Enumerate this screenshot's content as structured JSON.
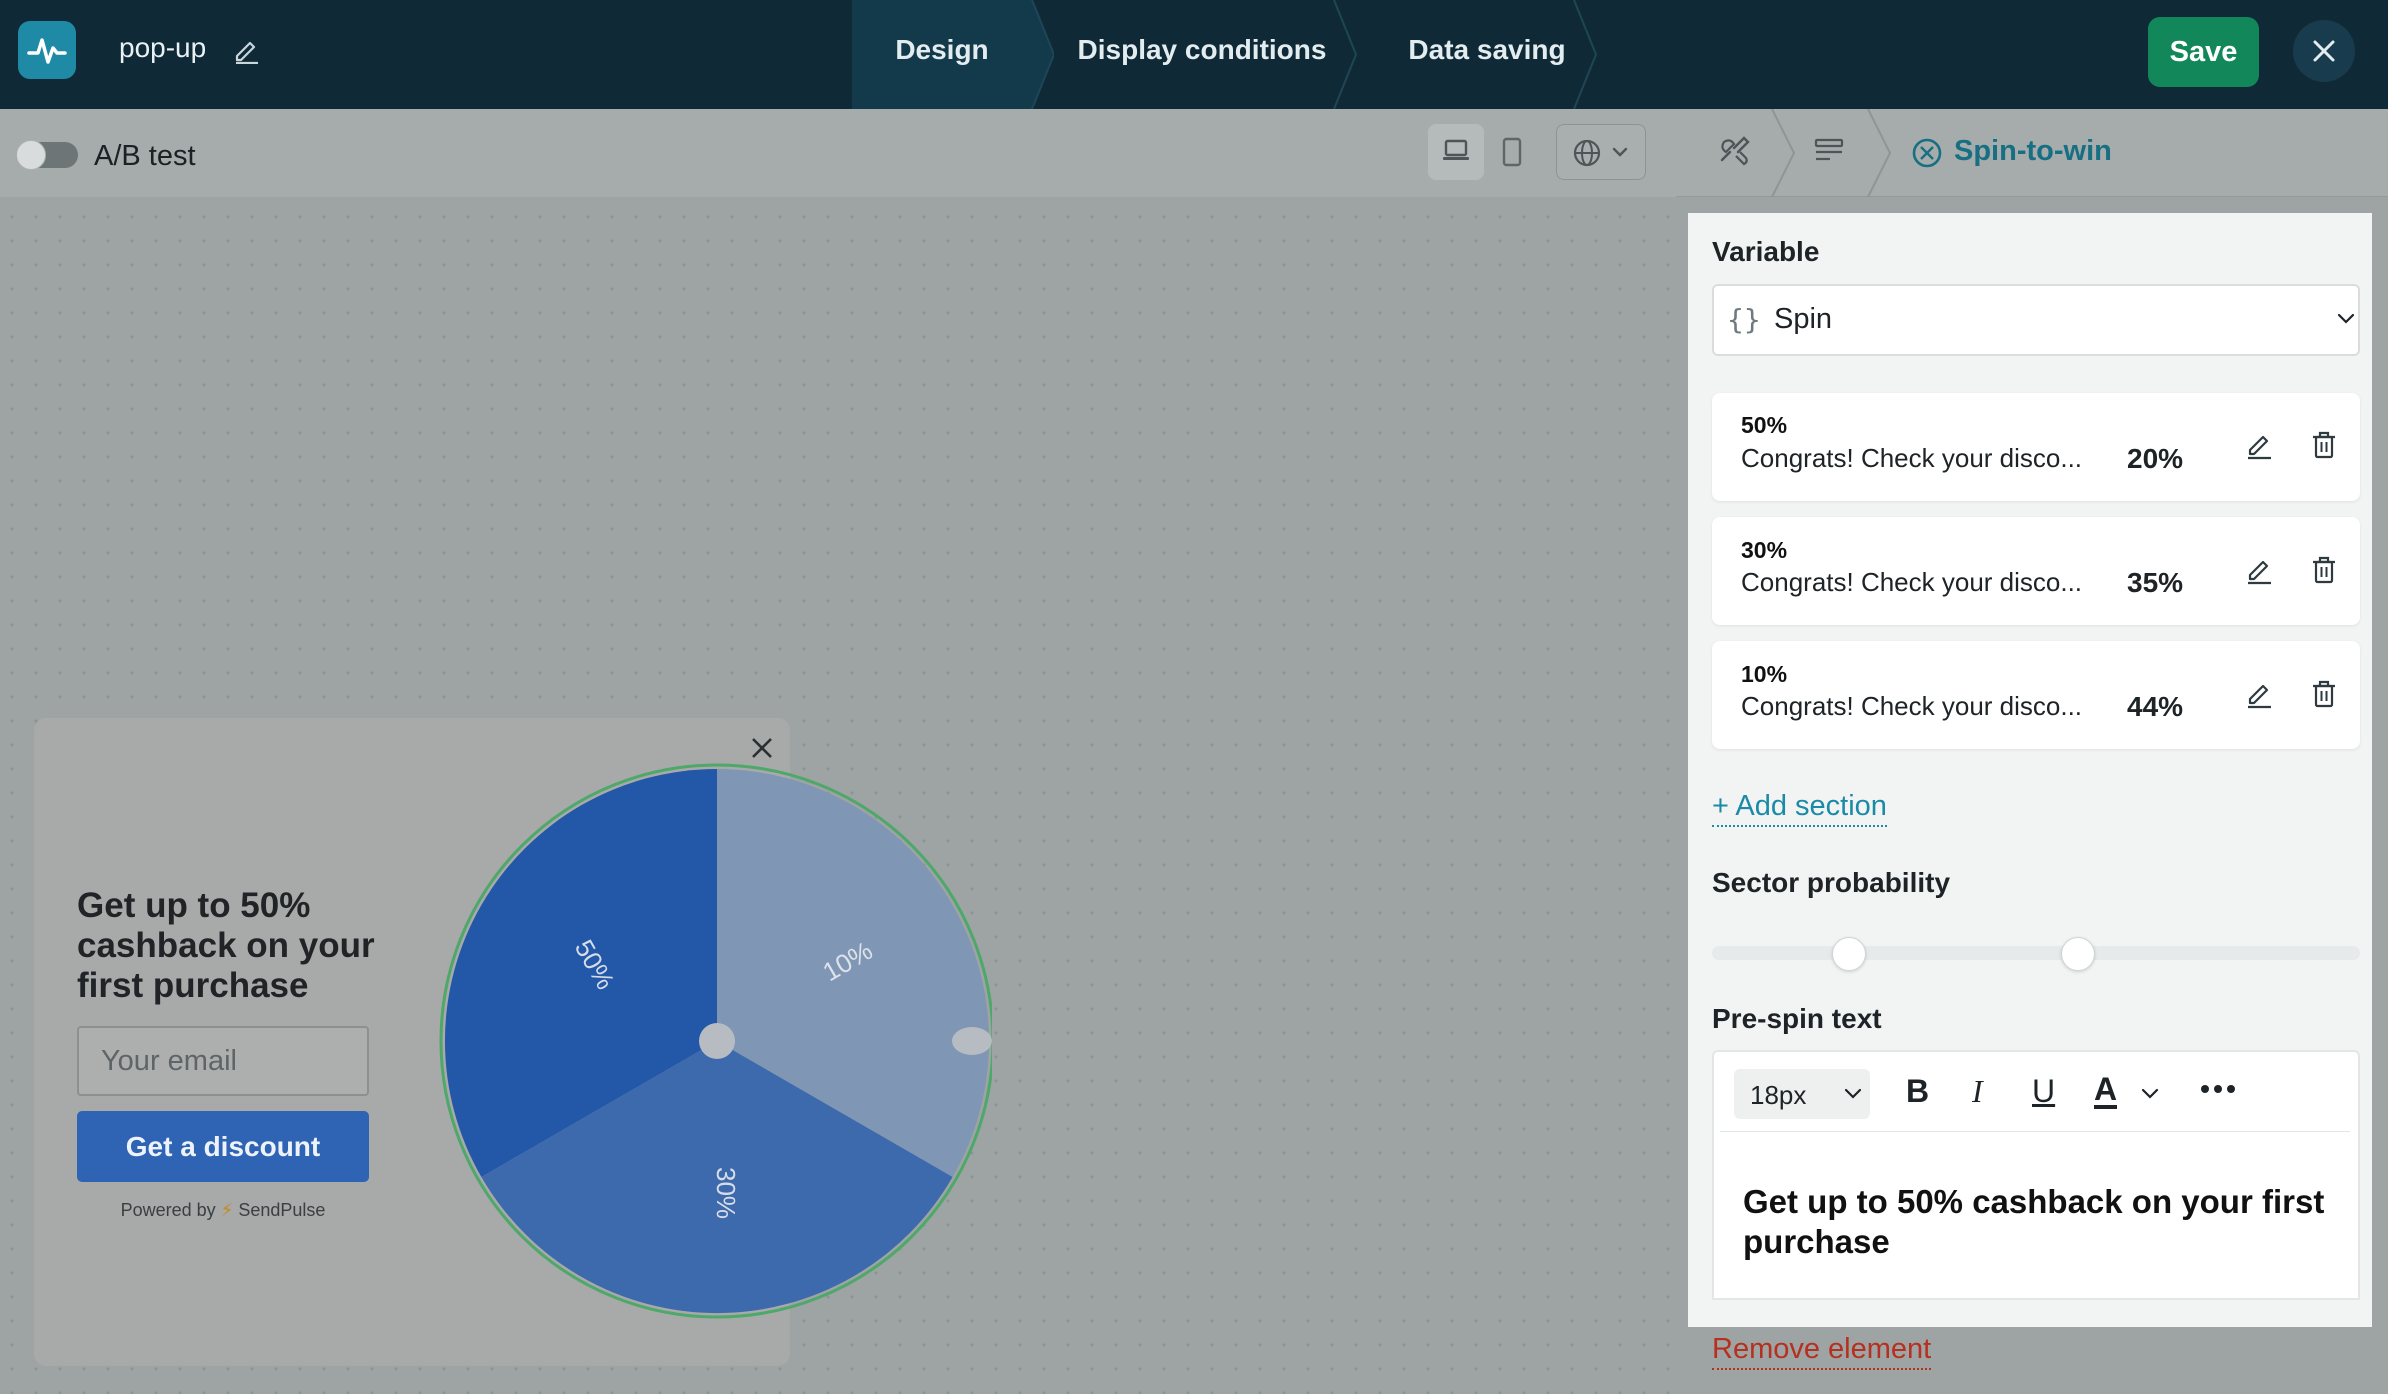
{
  "topbar": {
    "title": "pop-up",
    "steps": [
      {
        "label": "Design",
        "active": true
      },
      {
        "label": "Display conditions",
        "active": false
      },
      {
        "label": "Data saving",
        "active": false
      }
    ],
    "save_label": "Save"
  },
  "canvas_toolbar": {
    "ab_test_label": "A/B test",
    "ab_test_enabled": false
  },
  "popup": {
    "heading": "Get up to 50% cashback on your first purchase",
    "email_placeholder": "Your email",
    "button_label": "Get a discount",
    "powered_by": "Powered by",
    "brand": "SendPulse",
    "wheel_labels": [
      "50%",
      "10%",
      "30%"
    ],
    "wheel_colors": [
      "#2357a8",
      "#8096b5",
      "#3d6aad"
    ]
  },
  "panel": {
    "breadcrumb_current": "Spin-to-win",
    "variable_label": "Variable",
    "variable_value": "Spin",
    "sections": [
      {
        "name": "50%",
        "message": "Congrats! Check your disco...",
        "probability": "20%"
      },
      {
        "name": "30%",
        "message": "Congrats! Check your disco...",
        "probability": "35%"
      },
      {
        "name": "10%",
        "message": "Congrats! Check your disco...",
        "probability": "44%"
      }
    ],
    "add_section_label": "+ Add section",
    "sector_probability_label": "Sector probability",
    "pre_spin_label": "Pre-spin text",
    "font_size": "18px",
    "editor_text": "Get up to 50% cashback on your first purchase",
    "remove_label": "Remove element"
  },
  "colors": {
    "topbar_bg": "#0f2a36",
    "save_green": "#12885a",
    "accent_teal": "#176f83",
    "popup_button_blue": "#2f63b4",
    "remove_red": "#b5301f"
  }
}
